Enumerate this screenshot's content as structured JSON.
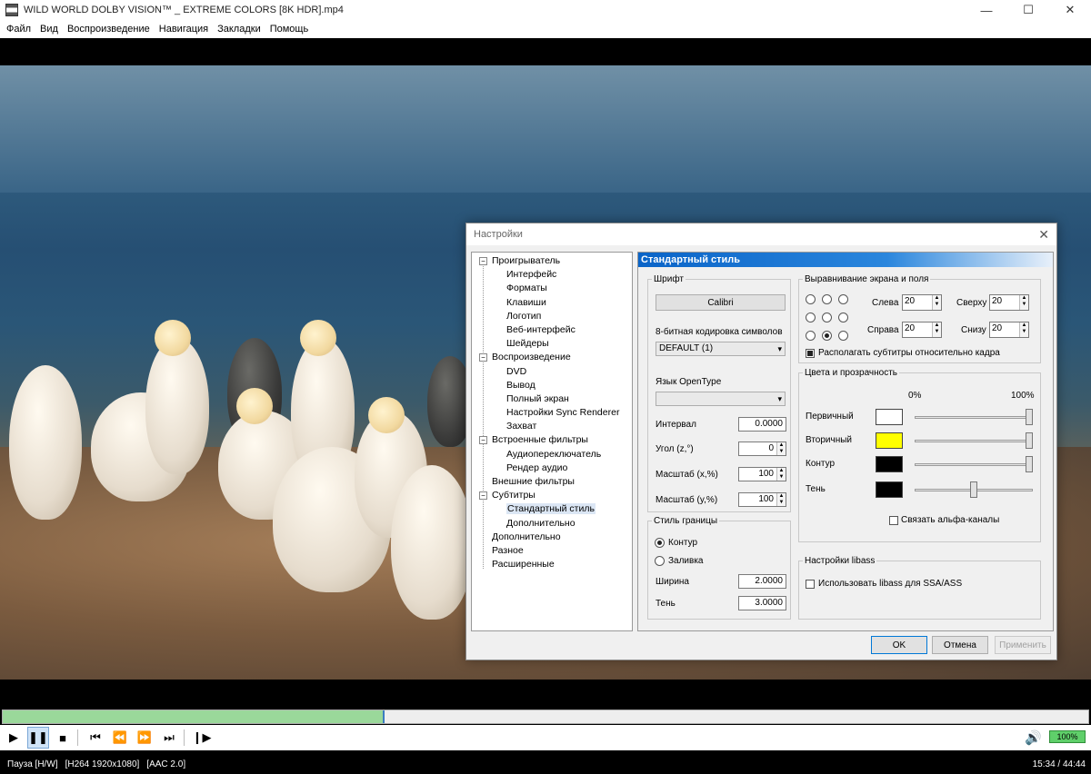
{
  "window": {
    "title": "WILD WORLD DOLBY VISION™ _ EXTREME COLORS [8K HDR].mp4",
    "minimize": "—",
    "maximize": "☐",
    "close": "✕"
  },
  "menu": [
    "Файл",
    "Вид",
    "Воспроизведение",
    "Навигация",
    "Закладки",
    "Помощь"
  ],
  "dialog": {
    "title": "Настройки",
    "close": "✕",
    "tree": [
      {
        "label": "Проигрыватель",
        "level": 0,
        "expander": "−"
      },
      {
        "label": "Интерфейс",
        "level": 1
      },
      {
        "label": "Форматы",
        "level": 1
      },
      {
        "label": "Клавиши",
        "level": 1
      },
      {
        "label": "Логотип",
        "level": 1
      },
      {
        "label": "Веб-интерфейс",
        "level": 1
      },
      {
        "label": "Шейдеры",
        "level": 1
      },
      {
        "label": "Воспроизведение",
        "level": 0,
        "expander": "−"
      },
      {
        "label": "DVD",
        "level": 1
      },
      {
        "label": "Вывод",
        "level": 1
      },
      {
        "label": "Полный экран",
        "level": 1
      },
      {
        "label": "Настройки Sync Renderer",
        "level": 1
      },
      {
        "label": "Захват",
        "level": 1
      },
      {
        "label": "Встроенные фильтры",
        "level": 0,
        "expander": "−"
      },
      {
        "label": "Аудиопереключатель",
        "level": 1
      },
      {
        "label": "Рендер аудио",
        "level": 1
      },
      {
        "label": "Внешние фильтры",
        "level": 0
      },
      {
        "label": "Субтитры",
        "level": 0,
        "expander": "−"
      },
      {
        "label": "Стандартный стиль",
        "level": 1,
        "selected": true
      },
      {
        "label": "Дополнительно",
        "level": 1
      },
      {
        "label": "Дополнительно",
        "level": 0
      },
      {
        "label": "Разное",
        "level": 0
      },
      {
        "label": "Расширенные",
        "level": 0
      }
    ],
    "panel_title": "Стандартный стиль",
    "font_group": {
      "legend": "Шрифт",
      "font_button": "Calibri",
      "charset_label": "8-битная кодировка символов",
      "charset_value": "DEFAULT (1)",
      "opentype_label": "Язык OpenType",
      "opentype_value": "",
      "interval_label": "Интервал",
      "interval_value": "0.0000",
      "angle_label": "Угол (z,°)",
      "angle_value": "0",
      "scale_x_label": "Масштаб (x,%)",
      "scale_x_value": "100",
      "scale_y_label": "Масштаб (y,%)",
      "scale_y_value": "100"
    },
    "border_group": {
      "legend": "Стиль границы",
      "outline_label": "Контур",
      "fill_label": "Заливка",
      "width_label": "Ширина",
      "width_value": "2.0000",
      "shadow_label": "Тень",
      "shadow_value": "3.0000"
    },
    "align_group": {
      "legend": "Выравнивание экрана и поля",
      "left_label": "Слева",
      "left_value": "20",
      "top_label": "Сверху",
      "top_value": "20",
      "right_label": "Справа",
      "right_value": "20",
      "bottom_label": "Снизу",
      "bottom_value": "20",
      "relative_label": "Располагать субтитры относительно кадра"
    },
    "colors_group": {
      "legend": "Цвета и прозрачность",
      "pct_0": "0%",
      "pct_100": "100%",
      "rows": [
        {
          "label": "Первичный",
          "color": "#ffffff",
          "opacity": 1.0
        },
        {
          "label": "Вторичный",
          "color": "#ffff00",
          "opacity": 1.0
        },
        {
          "label": "Контур",
          "color": "#000000",
          "opacity": 1.0
        },
        {
          "label": "Тень",
          "color": "#000000",
          "opacity": 0.5
        }
      ],
      "link_alpha_label": "Связать альфа-каналы"
    },
    "libass_group": {
      "legend": "Настройки libass",
      "use_libass_label": "Использовать libass для SSA/ASS"
    },
    "ok_label": "OK",
    "cancel_label": "Отмена",
    "apply_label": "Применить"
  },
  "player": {
    "progress": 0.35,
    "volume": "100%",
    "status": "Пауза [H/W]",
    "video_info": "[H264 1920x1080]",
    "audio_info": "[AAC 2.0]",
    "time": "15:34 / 44:44"
  },
  "icons": {
    "play": "play-icon",
    "pause": "pause-icon",
    "stop": "stop-icon",
    "volume": "speaker-icon"
  }
}
